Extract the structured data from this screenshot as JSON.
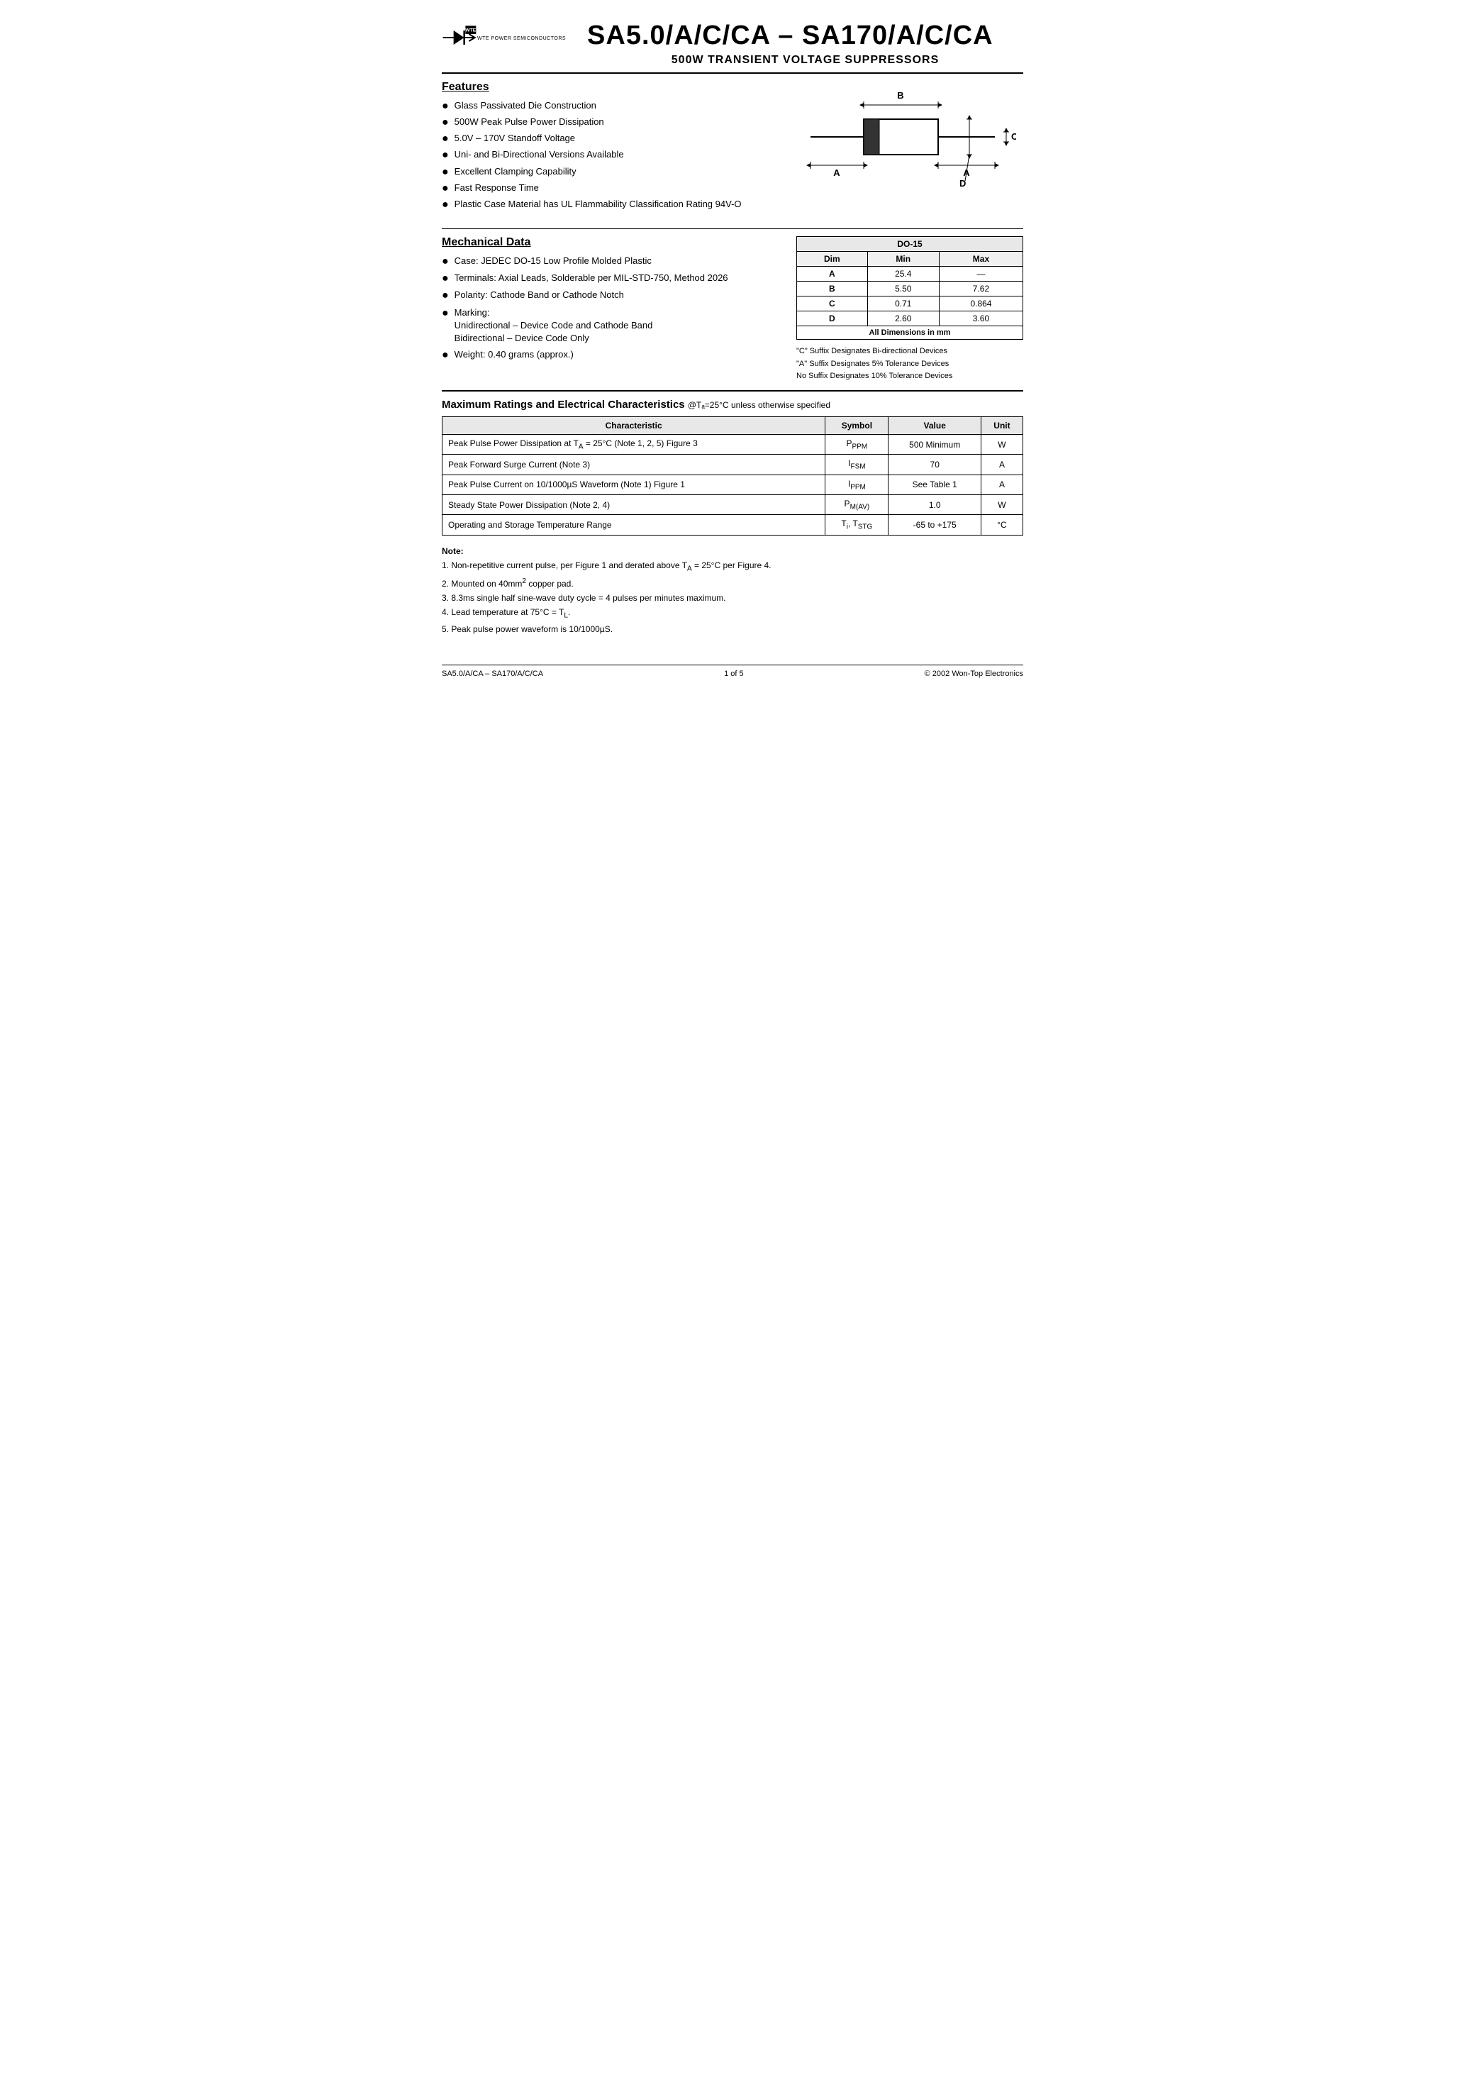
{
  "header": {
    "logo_alt": "WTE Power Semiconductors",
    "main_title": "SA5.0/A/C/CA – SA170/A/C/CA",
    "sub_title": "500W TRANSIENT VOLTAGE SUPPRESSORS"
  },
  "features": {
    "section_title": "Features",
    "items": [
      "Glass Passivated Die Construction",
      "500W Peak Pulse Power Dissipation",
      "5.0V – 170V Standoff Voltage",
      "Uni- and Bi-Directional Versions Available",
      "Excellent Clamping Capability",
      "Fast Response Time",
      "Plastic Case Material has UL Flammability Classification Rating 94V-O"
    ]
  },
  "mechanical": {
    "section_title": "Mechanical Data",
    "items": [
      "Case: JEDEC DO-15 Low Profile Molded Plastic",
      "Terminals: Axial Leads, Solderable per MIL-STD-750, Method 2026",
      "Polarity: Cathode Band or Cathode Notch",
      "Marking:\nUnidirectional – Device Code and Cathode Band\nBidirectional – Device Code Only",
      "Weight: 0.40 grams (approx.)"
    ]
  },
  "dimensions": {
    "package": "DO-15",
    "headers": [
      "Dim",
      "Min",
      "Max"
    ],
    "rows": [
      {
        "dim": "A",
        "min": "25.4",
        "max": "—"
      },
      {
        "dim": "B",
        "min": "5.50",
        "max": "7.62"
      },
      {
        "dim": "C",
        "min": "0.71",
        "max": "0.864"
      },
      {
        "dim": "D",
        "min": "2.60",
        "max": "3.60"
      }
    ],
    "footer": "All Dimensions in mm",
    "suffix_notes": [
      "\"C\" Suffix Designates Bi-directional Devices",
      "\"A\" Suffix Designates 5% Tolerance Devices",
      "No Suffix Designates 10% Tolerance Devices"
    ]
  },
  "ratings": {
    "title": "Maximum Ratings and Electrical Characteristics",
    "title_suffix": "@Tₐ=25°C unless otherwise specified",
    "headers": [
      "Characteristic",
      "Symbol",
      "Value",
      "Unit"
    ],
    "rows": [
      {
        "characteristic": "Peak Pulse Power Dissipation at Tₐ = 25°C (Note 1, 2, 5) Figure 3",
        "symbol": "PᴘᴘM",
        "value": "500 Minimum",
        "unit": "W"
      },
      {
        "characteristic": "Peak Forward Surge Current (Note 3)",
        "symbol": "IFSM",
        "value": "70",
        "unit": "A"
      },
      {
        "characteristic": "Peak Pulse Current on 10/1000µS Waveform (Note 1) Figure 1",
        "symbol": "IPPM",
        "value": "See Table 1",
        "unit": "A"
      },
      {
        "characteristic": "Steady State Power Dissipation (Note 2, 4)",
        "symbol": "PM(AV)",
        "value": "1.0",
        "unit": "W"
      },
      {
        "characteristic": "Operating and Storage Temperature Range",
        "symbol": "Ti, TSTG",
        "value": "-65 to +175",
        "unit": "°C"
      }
    ]
  },
  "notes": {
    "title": "Note:",
    "items": [
      "1. Non-repetitive current pulse, per Figure 1 and derated above Tₐ = 25°C per Figure 4.",
      "2. Mounted on 40mm² copper pad.",
      "3. 8.3ms single half sine-wave duty cycle = 4 pulses per minutes maximum.",
      "4. Lead temperature at 75°C = Tₗ.",
      "5. Peak pulse power waveform is 10/1000µS."
    ]
  },
  "footer": {
    "left": "SA5.0/A/CA – SA170/A/C/CA",
    "center": "1 of 5",
    "right": "© 2002 Won-Top Electronics"
  }
}
